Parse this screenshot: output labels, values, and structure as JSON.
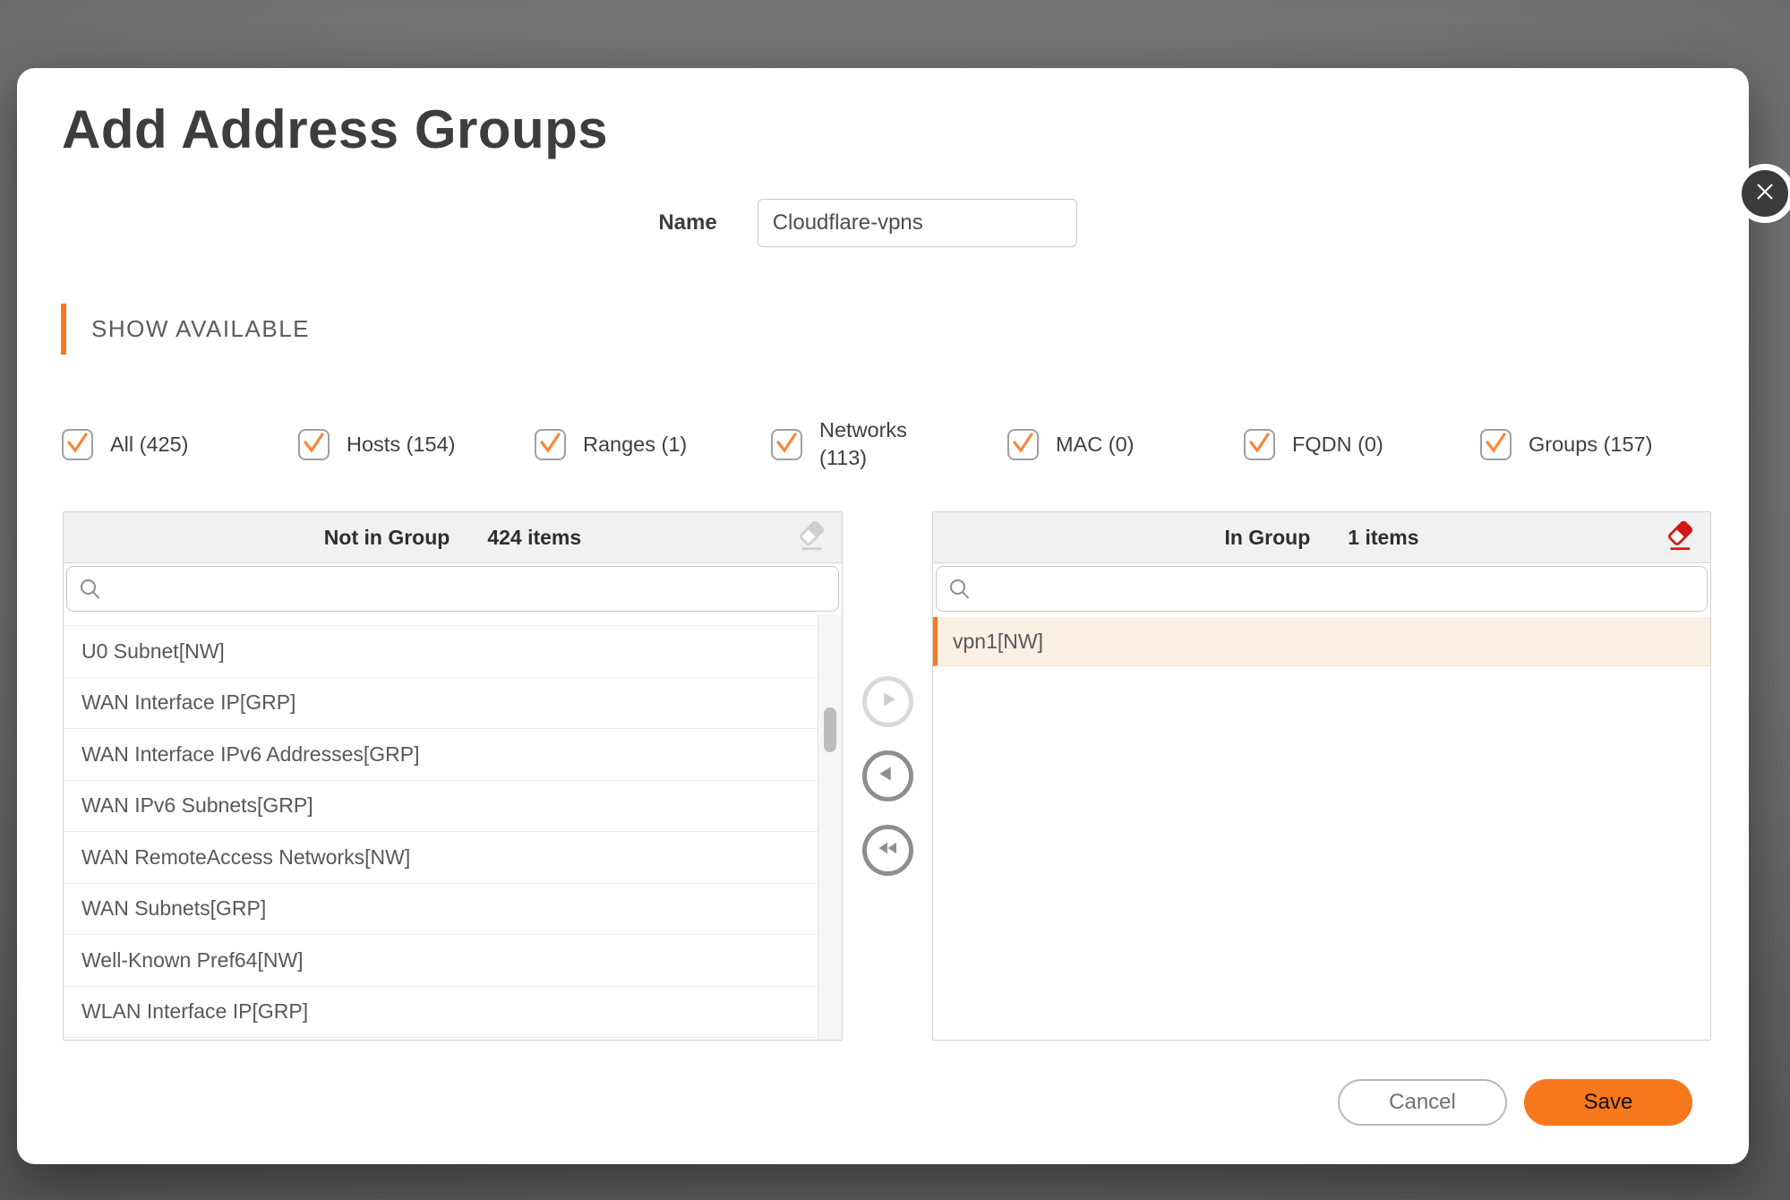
{
  "dialog": {
    "title": "Add Address Groups",
    "name_label": "Name",
    "name_value": "Cloudflare-vpns",
    "section_header": "SHOW AVAILABLE"
  },
  "filters": [
    "All (425)",
    "Hosts (154)",
    "Ranges (1)",
    "Networks (113)",
    "MAC (0)",
    "FQDN (0)",
    "Groups (157)"
  ],
  "not_in_group": {
    "title": "Not in Group",
    "count": "424 items",
    "search_value": "",
    "items": [
      "U0 Subnet[NW]",
      "WAN Interface IP[GRP]",
      "WAN Interface IPv6 Addresses[GRP]",
      "WAN IPv6 Subnets[GRP]",
      "WAN RemoteAccess Networks[NW]",
      "WAN Subnets[GRP]",
      "Well-Known Pref64[NW]",
      "WLAN Interface IP[GRP]"
    ]
  },
  "in_group": {
    "title": "In Group",
    "count": "1 items",
    "search_value": "",
    "items": [
      "vpn1[NW]"
    ]
  },
  "footer": {
    "cancel_label": "Cancel",
    "save_label": "Save"
  },
  "colors": {
    "accent_orange": "#f7791d",
    "check_orange": "#f6883a",
    "eraser_red": "#d01616",
    "eraser_gray": "#cfcfcf",
    "selected_row_bg": "#fcefe3"
  }
}
